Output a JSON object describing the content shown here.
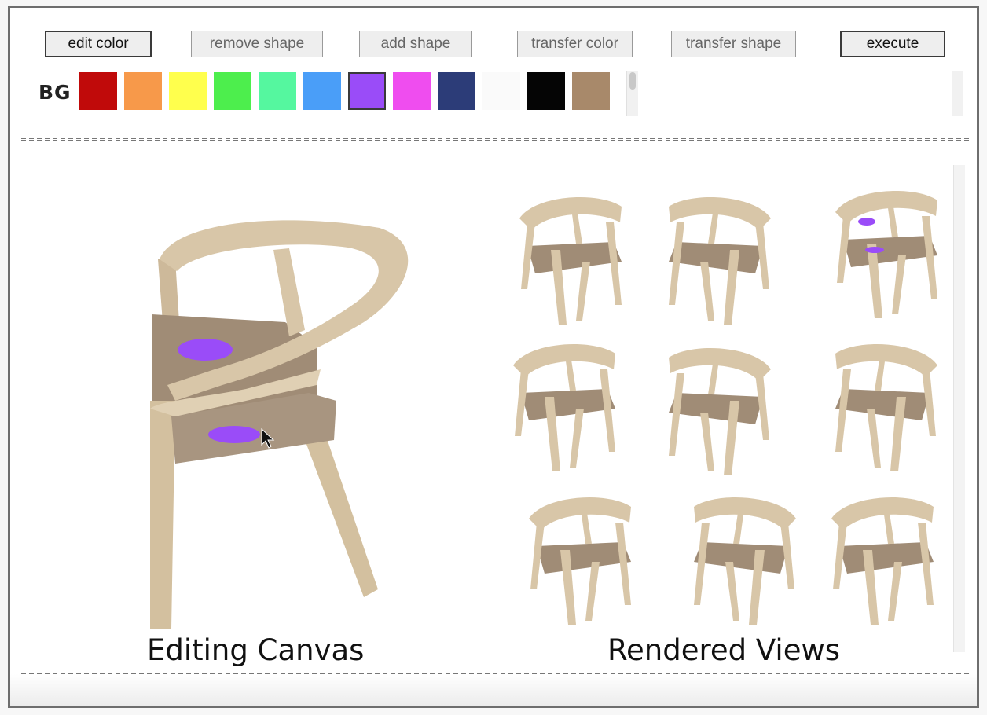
{
  "toolbar": {
    "buttons": [
      {
        "label": "edit color",
        "state": "active"
      },
      {
        "label": "remove shape",
        "state": "inactive"
      },
      {
        "label": "add shape",
        "state": "inactive"
      },
      {
        "label": "transfer color",
        "state": "inactive"
      },
      {
        "label": "transfer shape",
        "state": "inactive"
      },
      {
        "label": "execute",
        "state": "active"
      }
    ]
  },
  "palette": {
    "label": "BG",
    "swatches": [
      {
        "name": "red",
        "color": "#c00a0a"
      },
      {
        "name": "orange",
        "color": "#f7994a"
      },
      {
        "name": "yellow",
        "color": "#ffff4d"
      },
      {
        "name": "green",
        "color": "#4dee4d"
      },
      {
        "name": "mint",
        "color": "#55f79f"
      },
      {
        "name": "blue",
        "color": "#4a9ef8"
      },
      {
        "name": "purple",
        "color": "#9a4cf8",
        "selected": true
      },
      {
        "name": "magenta",
        "color": "#ef4def"
      },
      {
        "name": "navy",
        "color": "#2c3c78"
      },
      {
        "name": "white",
        "color": "#fafafa"
      },
      {
        "name": "black",
        "color": "#050505"
      },
      {
        "name": "tan",
        "color": "#a8896a"
      }
    ]
  },
  "canvas": {
    "label": "Editing Canvas",
    "paint_color": "#9a4cf8"
  },
  "views": {
    "label": "Rendered Views",
    "count": 9
  },
  "colors": {
    "chair_frame": "#d8c6a8",
    "chair_seat": "#a08c76"
  }
}
